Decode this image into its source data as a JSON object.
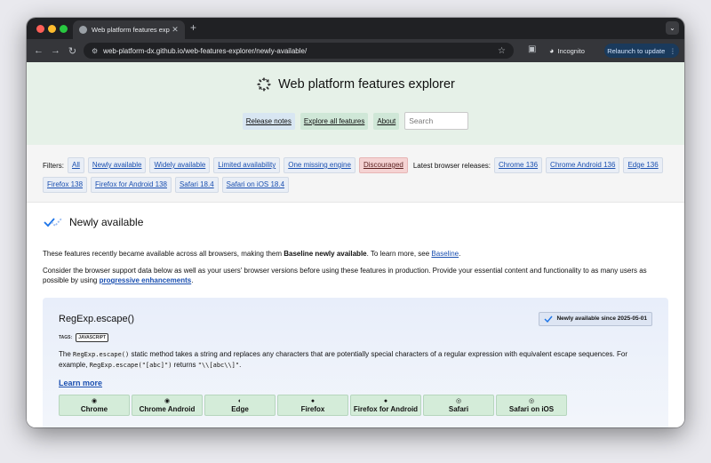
{
  "browser": {
    "tab_title": "Web platform features explor",
    "tab_close": "✕",
    "new_tab": "+",
    "tab_menu": "⌄",
    "url": "web-platform-dx.github.io/web-features-explorer/newly-available/",
    "incognito_label": "Incognito",
    "relaunch_label": "Relaunch to update",
    "icons": [
      "back-arrow-icon",
      "forward-arrow-icon",
      "reload-icon",
      "site-settings-icon",
      "bookmark-star-icon",
      "extensions-icon",
      "incognito-icon",
      "menu-dots-icon"
    ]
  },
  "header": {
    "title": "Web platform features explorer",
    "nav": [
      {
        "label": "Release notes"
      },
      {
        "label": "Explore all features"
      },
      {
        "label": "About"
      }
    ],
    "search_placeholder": "Search"
  },
  "filters": {
    "label": "Filters:",
    "items": [
      {
        "label": "All"
      },
      {
        "label": "Newly available"
      },
      {
        "label": "Widely available"
      },
      {
        "label": "Limited availability"
      },
      {
        "label": "One missing engine"
      },
      {
        "label": "Discouraged"
      }
    ],
    "releases_label": "Latest browser releases:",
    "releases": [
      {
        "label": "Chrome 136"
      },
      {
        "label": "Chrome Android 136"
      },
      {
        "label": "Edge 136"
      },
      {
        "label": "Firefox 138"
      },
      {
        "label": "Firefox for Android 138"
      },
      {
        "label": "Safari 18.4"
      },
      {
        "label": "Safari on iOS 18.4"
      }
    ],
    "colors": {
      "discouraged": "#f5d3d3",
      "pill": "#e9eef6"
    }
  },
  "section": {
    "title": "Newly available",
    "intro_before": "These features recently became available across all browsers, making them ",
    "intro_bold": "Baseline newly available",
    "intro_mid": ". To learn more, see ",
    "intro_link": "Baseline",
    "intro_end": ".",
    "advice_before": "Consider the browser support data below as well as your users' browser versions before using these features in production. Provide your essential content and functionality to as many users as possible by using ",
    "advice_link": "progressive enhancements",
    "advice_end": "."
  },
  "feature": {
    "name": "RegExp.escape()",
    "badge": "Newly available since 2025-05-01",
    "tags_label": "TAGS:",
    "tag": "JAVASCRIPT",
    "desc_1": "The ",
    "code_1": "RegExp.escape()",
    "desc_2": " static method takes a string and replaces any characters that are potentially special characters of a regular expression with equivalent escape sequences. For example, ",
    "code_2": "RegExp.escape(\"[abc]\")",
    "desc_3": " returns ",
    "code_3": "\"\\\\[abc\\\\]\"",
    "desc_4": ".",
    "learn_more": "Learn more",
    "browsers": [
      {
        "name": "Chrome",
        "icon": "chrome-icon"
      },
      {
        "name": "Chrome Android",
        "icon": "chrome-icon"
      },
      {
        "name": "Edge",
        "icon": "edge-icon"
      },
      {
        "name": "Firefox",
        "icon": "firefox-icon"
      },
      {
        "name": "Firefox for Android",
        "icon": "firefox-icon"
      },
      {
        "name": "Safari",
        "icon": "safari-icon"
      },
      {
        "name": "Safari on iOS",
        "icon": "safari-icon"
      }
    ],
    "colors": {
      "supported": "#d4ecd9",
      "card": "#e8eefa"
    }
  }
}
